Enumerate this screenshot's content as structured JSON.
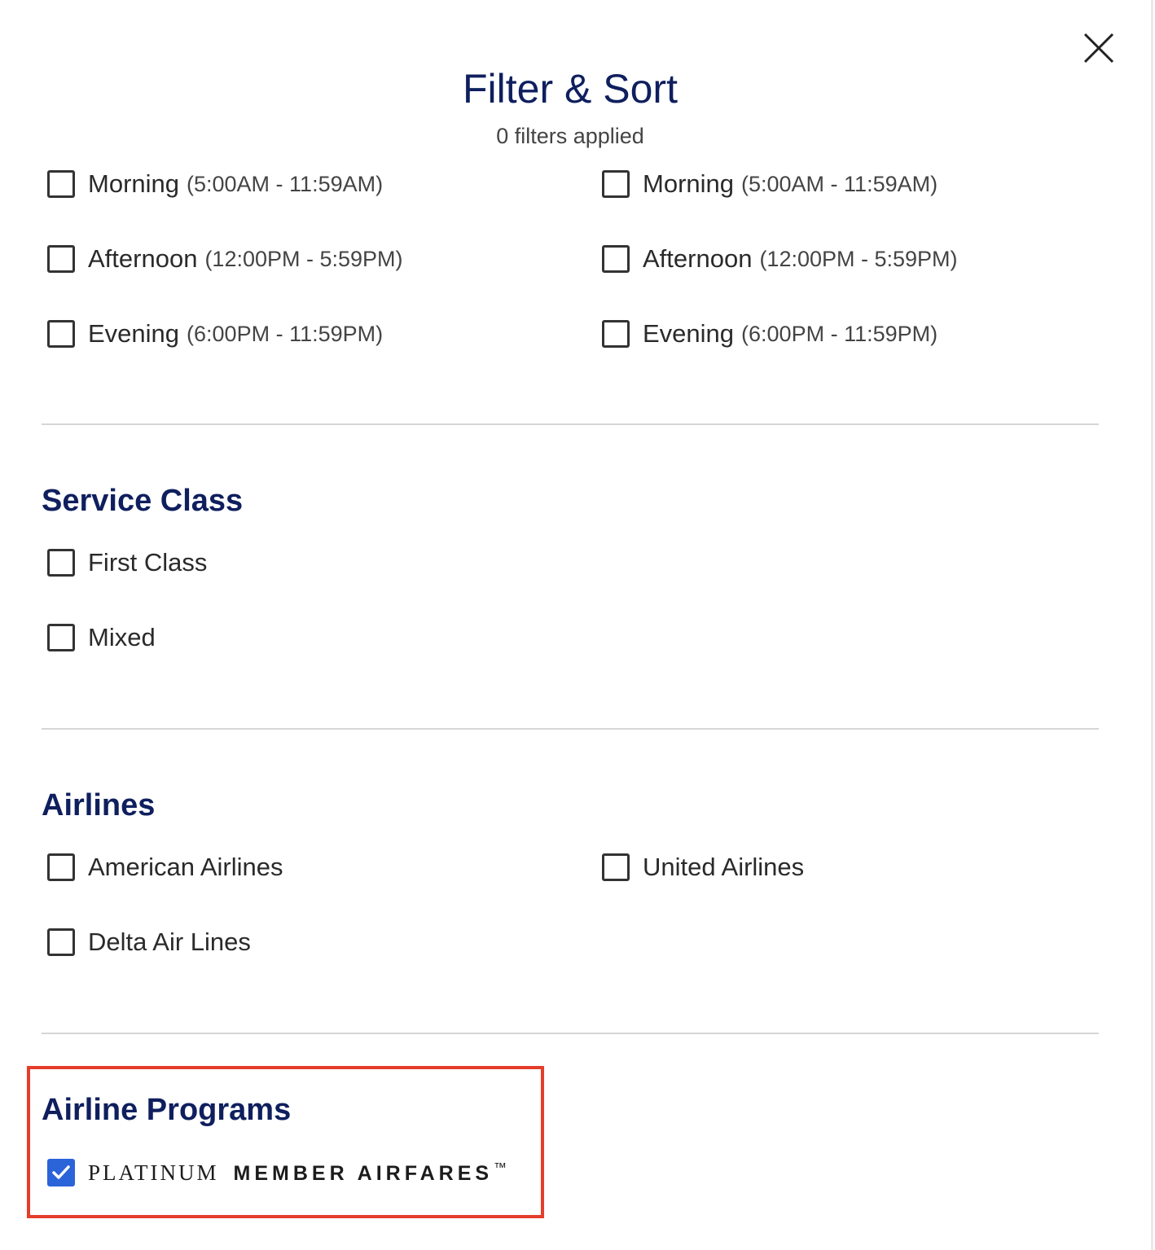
{
  "header": {
    "title": "Filter & Sort",
    "filters_applied": "0 filters applied"
  },
  "icons": {
    "close": "close-icon",
    "checkmark": "checkmark-icon"
  },
  "colors": {
    "heading": "#0f1f5e",
    "checkbox_checked": "#2b63d9",
    "highlight_border": "#e43d2a",
    "divider": "#d6d6d6"
  },
  "departure_times": {
    "left": [
      {
        "label": "Morning",
        "time": "(5:00AM - 11:59AM)",
        "checked": false
      },
      {
        "label": "Afternoon",
        "time": "(12:00PM - 5:59PM)",
        "checked": false
      },
      {
        "label": "Evening",
        "time": "(6:00PM - 11:59PM)",
        "checked": false
      }
    ],
    "right": [
      {
        "label": "Morning",
        "time": "(5:00AM - 11:59AM)",
        "checked": false
      },
      {
        "label": "Afternoon",
        "time": "(12:00PM - 5:59PM)",
        "checked": false
      },
      {
        "label": "Evening",
        "time": "(6:00PM - 11:59PM)",
        "checked": false
      }
    ]
  },
  "service_class": {
    "title": "Service Class",
    "options": [
      {
        "label": "First Class",
        "checked": false
      },
      {
        "label": "Mixed",
        "checked": false
      }
    ]
  },
  "airlines": {
    "title": "Airlines",
    "options": [
      {
        "label": "American Airlines",
        "checked": false
      },
      {
        "label": "United Airlines",
        "checked": false
      },
      {
        "label": "Delta Air Lines",
        "checked": false
      }
    ]
  },
  "airline_programs": {
    "title": "Airline Programs",
    "option": {
      "logo_word_1": "PLATINUM",
      "logo_word_2": "MEMBER AIRFARES",
      "trademark": "™",
      "checked": true
    }
  }
}
